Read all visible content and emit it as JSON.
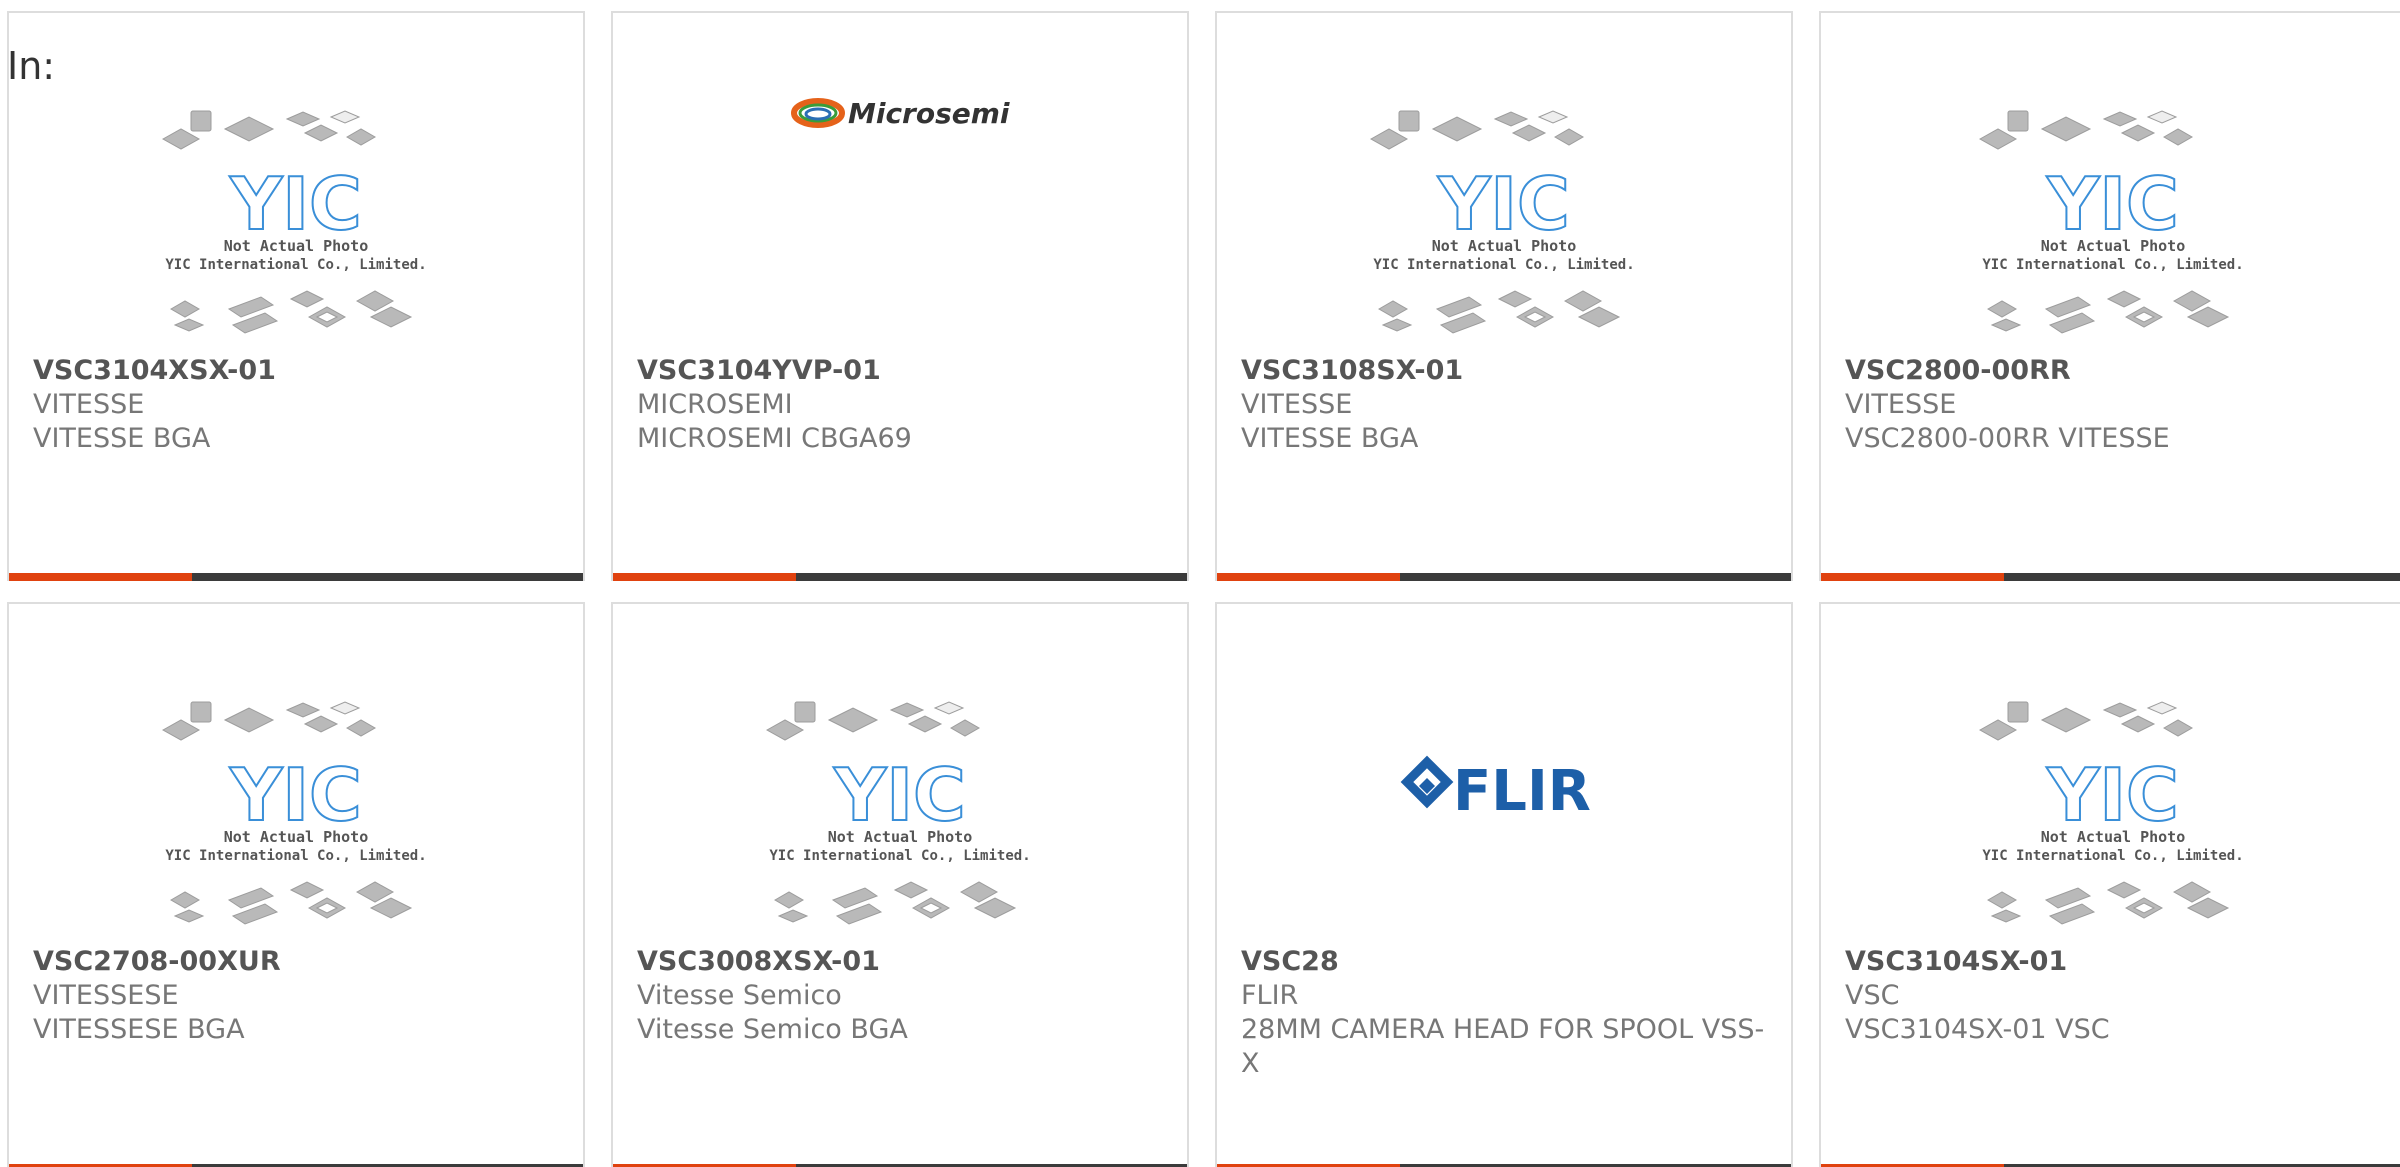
{
  "header": {
    "in_label": "In:"
  },
  "theme": {
    "accent": "#e0420f",
    "bar": "#3b3b3b",
    "border": "#dddddd"
  },
  "placeholder": {
    "brand": "YIC",
    "caption_line1": "Not Actual Photo",
    "caption_line2": "YIC International Co., Limited."
  },
  "logos": {
    "microsemi": "Microsemi",
    "flir": "FLIR"
  },
  "products": [
    {
      "part": "VSC3104XSX-01",
      "maker": "VITESSE",
      "desc": "VITESSE BGA",
      "image": "placeholder"
    },
    {
      "part": "VSC3104YVP-01",
      "maker": "MICROSEMI",
      "desc": "MICROSEMI CBGA69",
      "image": "microsemi-logo"
    },
    {
      "part": "VSC3108SX-01",
      "maker": "VITESSE",
      "desc": "VITESSE BGA",
      "image": "placeholder"
    },
    {
      "part": "VSC2800-00RR",
      "maker": "VITESSE",
      "desc": "VSC2800-00RR VITESSE",
      "image": "placeholder"
    },
    {
      "part": "VSC2708-00XUR",
      "maker": "VITESSESE",
      "desc": "VITESSESE BGA",
      "image": "placeholder"
    },
    {
      "part": "VSC3008XSX-01",
      "maker": "Vitesse Semico",
      "desc": "Vitesse Semico BGA",
      "image": "placeholder"
    },
    {
      "part": "VSC28",
      "maker": "FLIR",
      "desc": "28MM CAMERA HEAD FOR SPOOL VSS-X",
      "image": "flir-logo"
    },
    {
      "part": "VSC3104SX-01",
      "maker": "VSC",
      "desc": "VSC3104SX-01 VSC",
      "image": "placeholder"
    }
  ]
}
